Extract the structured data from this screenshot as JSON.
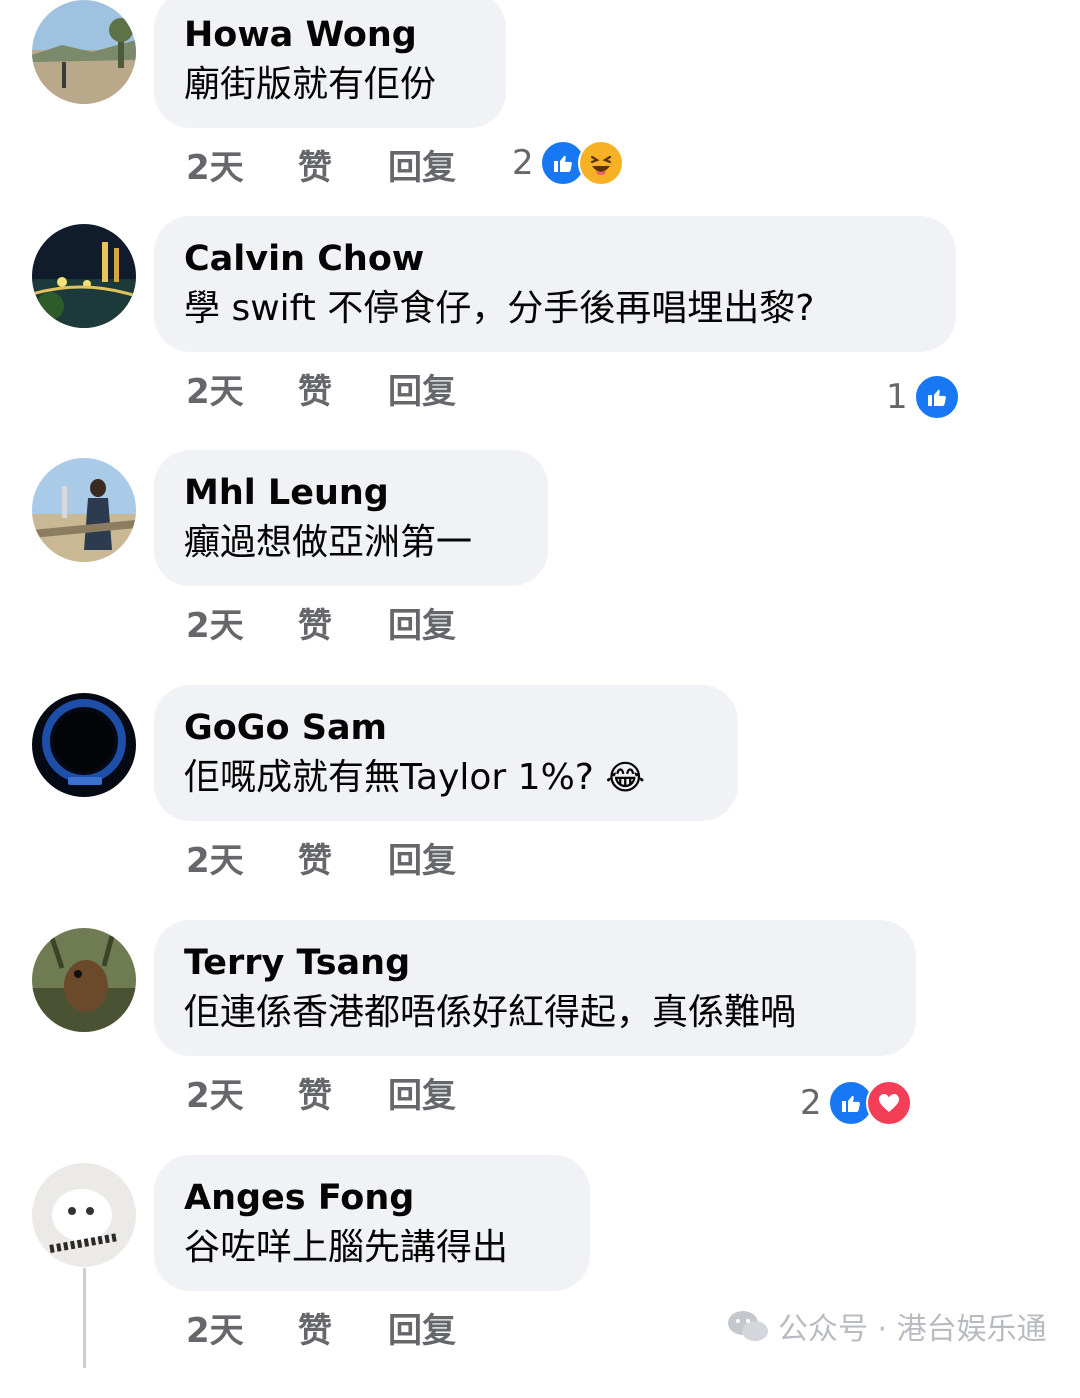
{
  "comments": [
    {
      "name": "Howa Wong",
      "text": "廟街版就有佢份",
      "time": "2天",
      "like": "赞",
      "reply": "回复",
      "reaction_count": "2",
      "reactions": [
        "like-icon",
        "haha-icon"
      ]
    },
    {
      "name": "Calvin Chow",
      "text": "學 swift 不停食仔，分手後再唱埋出黎?",
      "time": "2天",
      "like": "赞",
      "reply": "回复",
      "reaction_count": "1",
      "reactions": [
        "like-icon"
      ]
    },
    {
      "name": "Mhl Leung",
      "text": "癲過想做亞洲第一",
      "time": "2天",
      "like": "赞",
      "reply": "回复",
      "reaction_count": "",
      "reactions": []
    },
    {
      "name": "GoGo Sam",
      "text": "佢嘅成就有無Taylor 1%?",
      "emoji": "😂",
      "time": "2天",
      "like": "赞",
      "reply": "回复",
      "reaction_count": "",
      "reactions": []
    },
    {
      "name": "Terry Tsang",
      "text": "佢連係香港都唔係好紅得起，真係難喎",
      "time": "2天",
      "like": "赞",
      "reply": "回复",
      "reaction_count": "2",
      "reactions": [
        "like-icon",
        "heart-icon"
      ]
    },
    {
      "name": "Anges Fong",
      "text": "谷咗咩上腦先講得出",
      "time": "2天",
      "like": "赞",
      "reply": "回复",
      "reaction_count": "",
      "reactions": []
    }
  ],
  "watermark": {
    "text": "公众号 · 港台娱乐通",
    "icon": "wechat-icon"
  },
  "colors": {
    "bubble": "#f0f2f5",
    "meta": "#65676b",
    "like": "#1877f2",
    "heart": "#f33e58",
    "haha": "#f7b125"
  }
}
